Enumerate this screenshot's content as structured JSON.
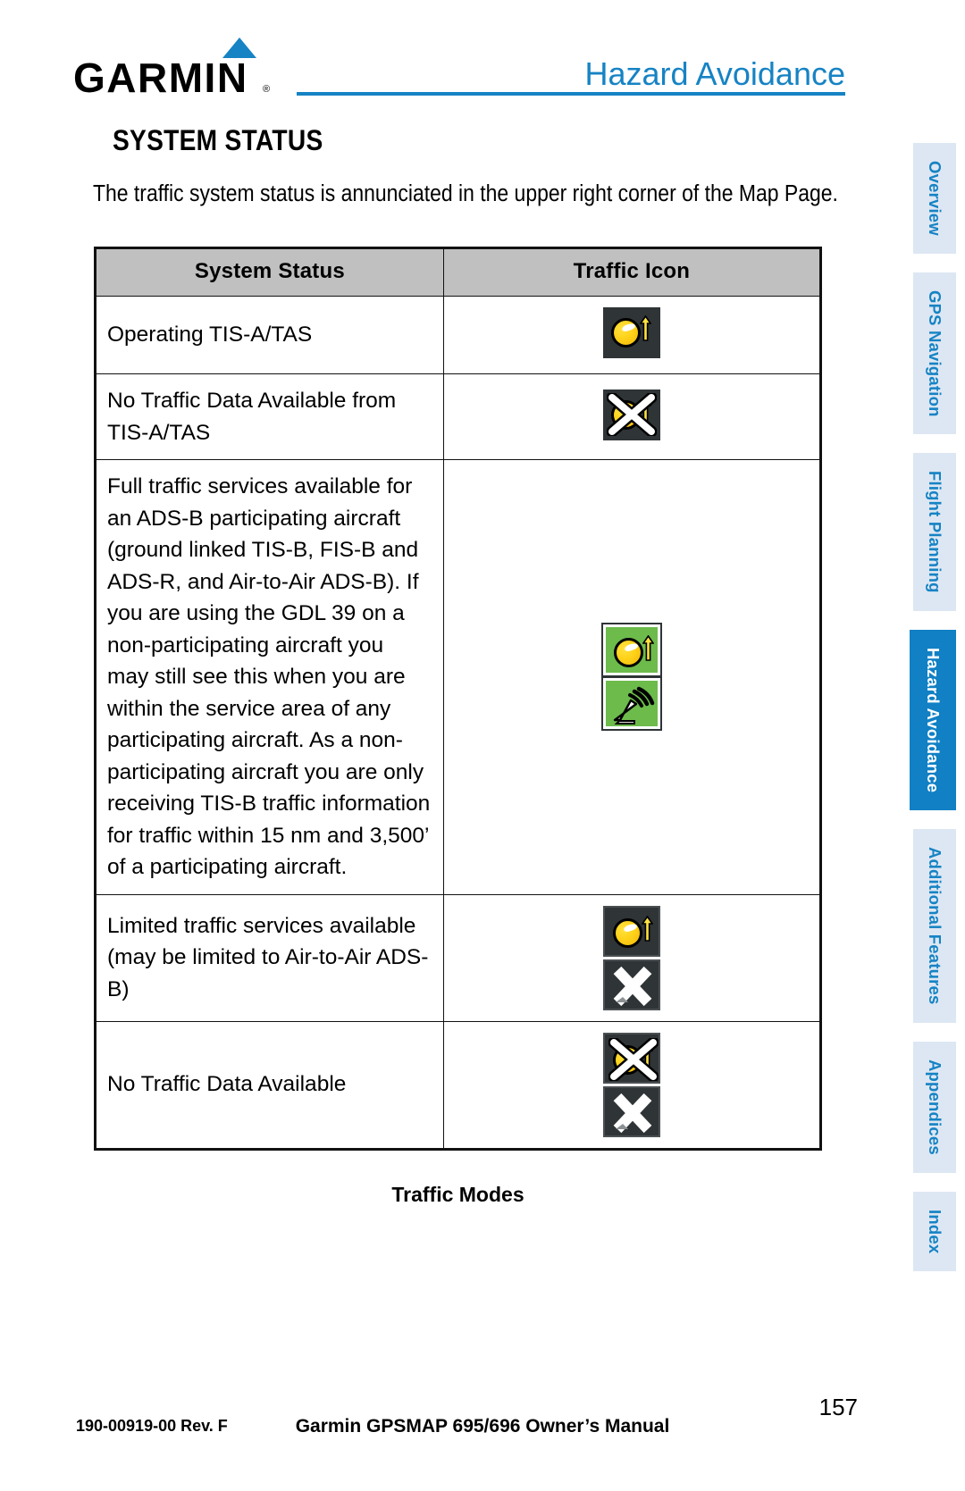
{
  "header": {
    "brand": "GARMIN",
    "brand_mark": "®",
    "title": "Hazard Avoidance",
    "accent_color": "#1683c4"
  },
  "section": {
    "heading": "SYSTEM STATUS",
    "intro": "The traffic system status is annunciated in the upper right corner of the Map Page."
  },
  "table": {
    "columns": [
      "System Status",
      "Traffic Icon"
    ],
    "header_bg": "#c0c0c0",
    "rows": [
      {
        "status": "Operating TIS-A/TAS",
        "icons": [
          "traffic-ball-antenna-dark"
        ]
      },
      {
        "status": "No Traffic Data Available from TIS-A/TAS",
        "icons": [
          "traffic-ball-crossed-dark"
        ]
      },
      {
        "status": "Full traffic services available for an ADS-B participating aircraft (ground linked TIS-B, FIS-B and ADS-R, and Air-to-Air ADS-B).  If you are using the GDL 39 on a non-participating aircraft you may still see this when you are within the service area of any participating aircraft.  As a non-participating aircraft you are only receiving TIS-B traffic information for traffic within 15 nm and 3,500’ of a participating aircraft.",
        "icons": [
          "traffic-ball-antenna-green",
          "adsb-dish-green"
        ]
      },
      {
        "status": "Limited traffic services available (may be limited to Air-to-Air ADS-B)",
        "icons": [
          "traffic-ball-antenna-dark",
          "big-x-dark"
        ]
      },
      {
        "status": "No Traffic Data Available",
        "icons": [
          "traffic-ball-crossed-dark",
          "big-x-dark"
        ]
      }
    ]
  },
  "caption": "Traffic Modes",
  "sidebar": {
    "tabs": [
      {
        "label": "Overview",
        "active": false
      },
      {
        "label": "GPS Navigation",
        "active": false
      },
      {
        "label": "Flight Planning",
        "active": false
      },
      {
        "label": "Hazard Avoidance",
        "active": true
      },
      {
        "label": "Additional Features",
        "active": false
      },
      {
        "label": "Appendices",
        "active": false
      },
      {
        "label": "Index",
        "active": false
      }
    ],
    "inactive_bg": "#dde7f3",
    "active_bg": "#1180c4"
  },
  "footer": {
    "doc_number": "190-00919-00 Rev. F",
    "manual_title": "Garmin GPSMAP 695/696 Owner’s Manual",
    "page_number": "157"
  }
}
